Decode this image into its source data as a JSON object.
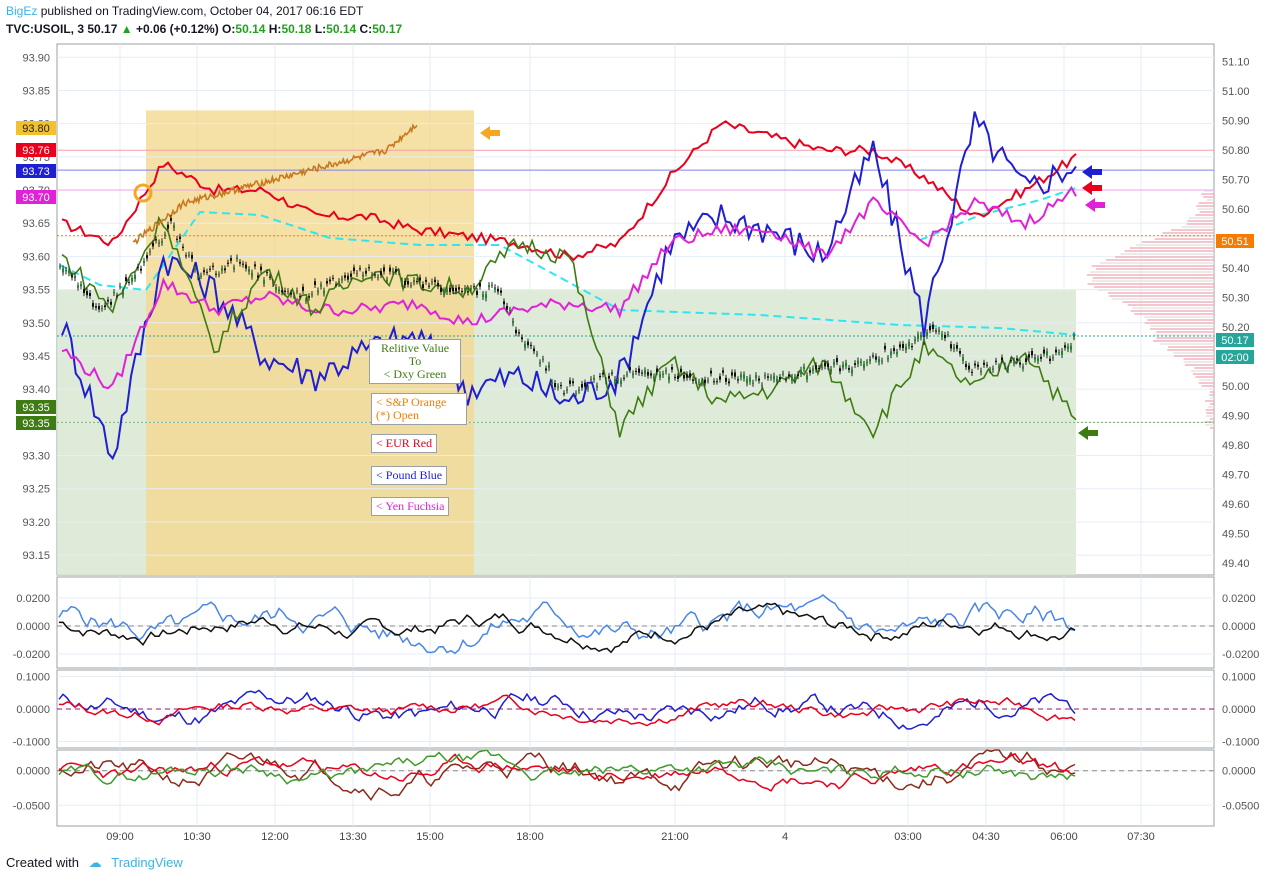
{
  "header": {
    "author": "BigEz",
    "published": "published on TradingView.com, October 04, 2017 06:16 EDT",
    "symbol": "TVC:USOIL, 3",
    "last": "50.17",
    "change": "+0.06 (+0.12%)",
    "o_label": "O:",
    "o": "50.14",
    "h_label": "H:",
    "h": "50.18",
    "l_label": "L:",
    "l": "50.14",
    "c_label": "C:",
    "c": "50.17"
  },
  "footer": {
    "created_with": "Created with",
    "brand": "TradingView"
  },
  "colors": {
    "grid": "#e6edf5",
    "candle_up": "#26a69a",
    "eur": "#e8001c",
    "pound": "#1f1fd1",
    "yen": "#e021d8",
    "dxy": "#3e7b12",
    "sp": "#c8781f",
    "cyan": "#2ee6f0",
    "orange_band": "#f2d88e",
    "green_band": "#d9e8d2"
  },
  "legend": {
    "dxy": [
      "Relitive Value",
      "To",
      "< Dxy Green"
    ],
    "sp": [
      "< S&P Orange",
      "(*) Open"
    ],
    "eur": "< EUR Red",
    "pound": "< Pound Blue",
    "yen": "< Yen Fuchsia"
  },
  "chart_data": [
    {
      "type": "line",
      "title": "TVC:USOIL, 3",
      "left_axis": {
        "ticks": [
          "93.90",
          "93.85",
          "93.80",
          "93.75",
          "93.70",
          "93.65",
          "93.60",
          "93.55",
          "93.50",
          "93.45",
          "93.40",
          "93.35",
          "93.30",
          "93.25",
          "93.20",
          "93.15"
        ],
        "ylim": [
          93.12,
          93.92
        ]
      },
      "right_axis": {
        "ticks": [
          "51.10",
          "51.00",
          "50.90",
          "50.80",
          "50.70",
          "50.60",
          "50.50",
          "50.40",
          "50.30",
          "50.20",
          "50.10",
          "50.00",
          "49.90",
          "49.80",
          "49.70",
          "49.60",
          "49.50",
          "49.40"
        ],
        "ylim": [
          49.36,
          51.16
        ]
      },
      "x_ticks": [
        "09:00",
        "10:30",
        "12:00",
        "13:30",
        "15:00",
        "18:00",
        "21:00",
        "4",
        "03:00",
        "04:30",
        "06:00",
        "07:30"
      ],
      "price_labels_left": [
        {
          "text": "93.80",
          "color": "#f2c12e"
        },
        {
          "text": "93.76",
          "color": "#e8001c"
        },
        {
          "text": "93.73",
          "color": "#1f1fd1"
        },
        {
          "text": "93.70",
          "color": "#e021d8"
        },
        {
          "text": "93.35",
          "color": "#3e7b12"
        },
        {
          "text": "93.35",
          "color": "#3e7b12"
        }
      ],
      "price_labels_right": [
        {
          "text": "50.51",
          "color": "#f57c00"
        },
        {
          "text": "50.17",
          "color": "#26a69a"
        },
        {
          "text": "02:00",
          "color": "#26a69a"
        }
      ],
      "series": [
        {
          "name": "< EUR Red",
          "color": "#e8001c",
          "x": [
            0,
            0.05,
            0.1,
            0.15,
            0.2,
            0.25,
            0.3,
            0.35,
            0.4,
            0.45,
            0.5,
            0.55,
            0.6,
            0.65,
            0.7,
            0.75,
            0.8,
            0.85,
            0.9,
            0.95,
            1.0
          ],
          "y": [
            93.65,
            93.62,
            93.74,
            93.7,
            93.7,
            93.66,
            93.66,
            93.64,
            93.63,
            93.62,
            93.6,
            93.62,
            93.72,
            93.8,
            93.78,
            93.76,
            93.76,
            93.72,
            93.66,
            93.7,
            93.75
          ]
        },
        {
          "name": "< Pound Blue",
          "color": "#1f1fd1",
          "x": [
            0,
            0.05,
            0.1,
            0.15,
            0.2,
            0.25,
            0.3,
            0.35,
            0.4,
            0.45,
            0.5,
            0.55,
            0.6,
            0.65,
            0.7,
            0.75,
            0.8,
            0.85,
            0.9,
            0.95,
            1.0
          ],
          "y": [
            93.5,
            93.3,
            93.6,
            93.55,
            93.45,
            93.42,
            93.46,
            93.48,
            93.4,
            93.42,
            93.38,
            93.42,
            93.62,
            93.66,
            93.64,
            93.6,
            93.76,
            93.5,
            93.8,
            93.7,
            93.74
          ]
        },
        {
          "name": "< Yen Fuchsia",
          "color": "#e021d8",
          "x": [
            0,
            0.05,
            0.1,
            0.15,
            0.2,
            0.25,
            0.3,
            0.35,
            0.4,
            0.45,
            0.5,
            0.55,
            0.6,
            0.65,
            0.7,
            0.75,
            0.8,
            0.85,
            0.9,
            0.95,
            1.0
          ],
          "y": [
            93.46,
            93.4,
            93.56,
            93.52,
            93.54,
            93.52,
            93.52,
            93.53,
            93.5,
            93.52,
            93.53,
            93.52,
            93.62,
            93.64,
            93.64,
            93.6,
            93.68,
            93.62,
            93.68,
            93.65,
            93.7
          ]
        },
        {
          "name": "< Dxy Green",
          "color": "#3e7b12",
          "x": [
            0,
            0.05,
            0.1,
            0.15,
            0.2,
            0.25,
            0.3,
            0.35,
            0.4,
            0.45,
            0.5,
            0.55,
            0.6,
            0.65,
            0.7,
            0.75,
            0.8,
            0.85,
            0.9,
            0.95,
            1.0
          ],
          "y": [
            93.6,
            93.52,
            93.66,
            93.46,
            93.58,
            93.52,
            93.58,
            93.56,
            93.55,
            93.62,
            93.6,
            93.34,
            93.44,
            93.38,
            93.4,
            93.44,
            93.34,
            93.46,
            93.4,
            93.46,
            93.35
          ]
        },
        {
          "name": "< S&P Orange",
          "color": "#c8781f",
          "x": [
            0.07,
            0.12,
            0.17,
            0.22,
            0.27,
            0.32,
            0.35
          ],
          "y": [
            93.62,
            93.68,
            93.7,
            93.72,
            93.74,
            93.76,
            93.8
          ]
        }
      ]
    },
    {
      "type": "line",
      "title": "",
      "ylim": [
        -0.03,
        0.035
      ],
      "ticks": [
        "0.0200",
        "0.0000",
        "-0.0200"
      ]
    },
    {
      "type": "line",
      "title": "",
      "ylim": [
        -0.12,
        0.12
      ],
      "ticks": [
        "0.1000",
        "0.0000",
        "-0.1000"
      ]
    },
    {
      "type": "line",
      "title": "",
      "ylim": [
        -0.08,
        0.03
      ],
      "ticks": [
        "0.0000",
        "-0.0500"
      ]
    }
  ]
}
